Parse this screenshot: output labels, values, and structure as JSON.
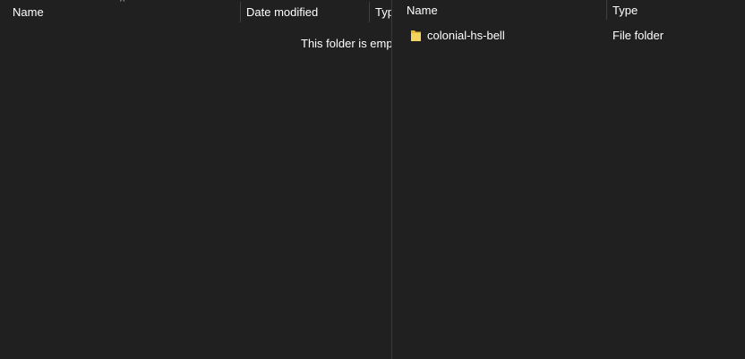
{
  "left_pane": {
    "columns": {
      "name": "Name",
      "date_modified": "Date modified",
      "type": "Type"
    },
    "sort_indicator": "^",
    "empty_message": "This folder is empty."
  },
  "right_pane": {
    "columns": {
      "name": "Name",
      "type": "Type"
    },
    "sort_indicator": "^",
    "items": [
      {
        "name": "colonial-hs-bell",
        "type": "File folder",
        "icon": "folder-icon"
      }
    ]
  },
  "colors": {
    "background": "#202020",
    "text": "#ffffff",
    "folder": "#f0c84c"
  }
}
